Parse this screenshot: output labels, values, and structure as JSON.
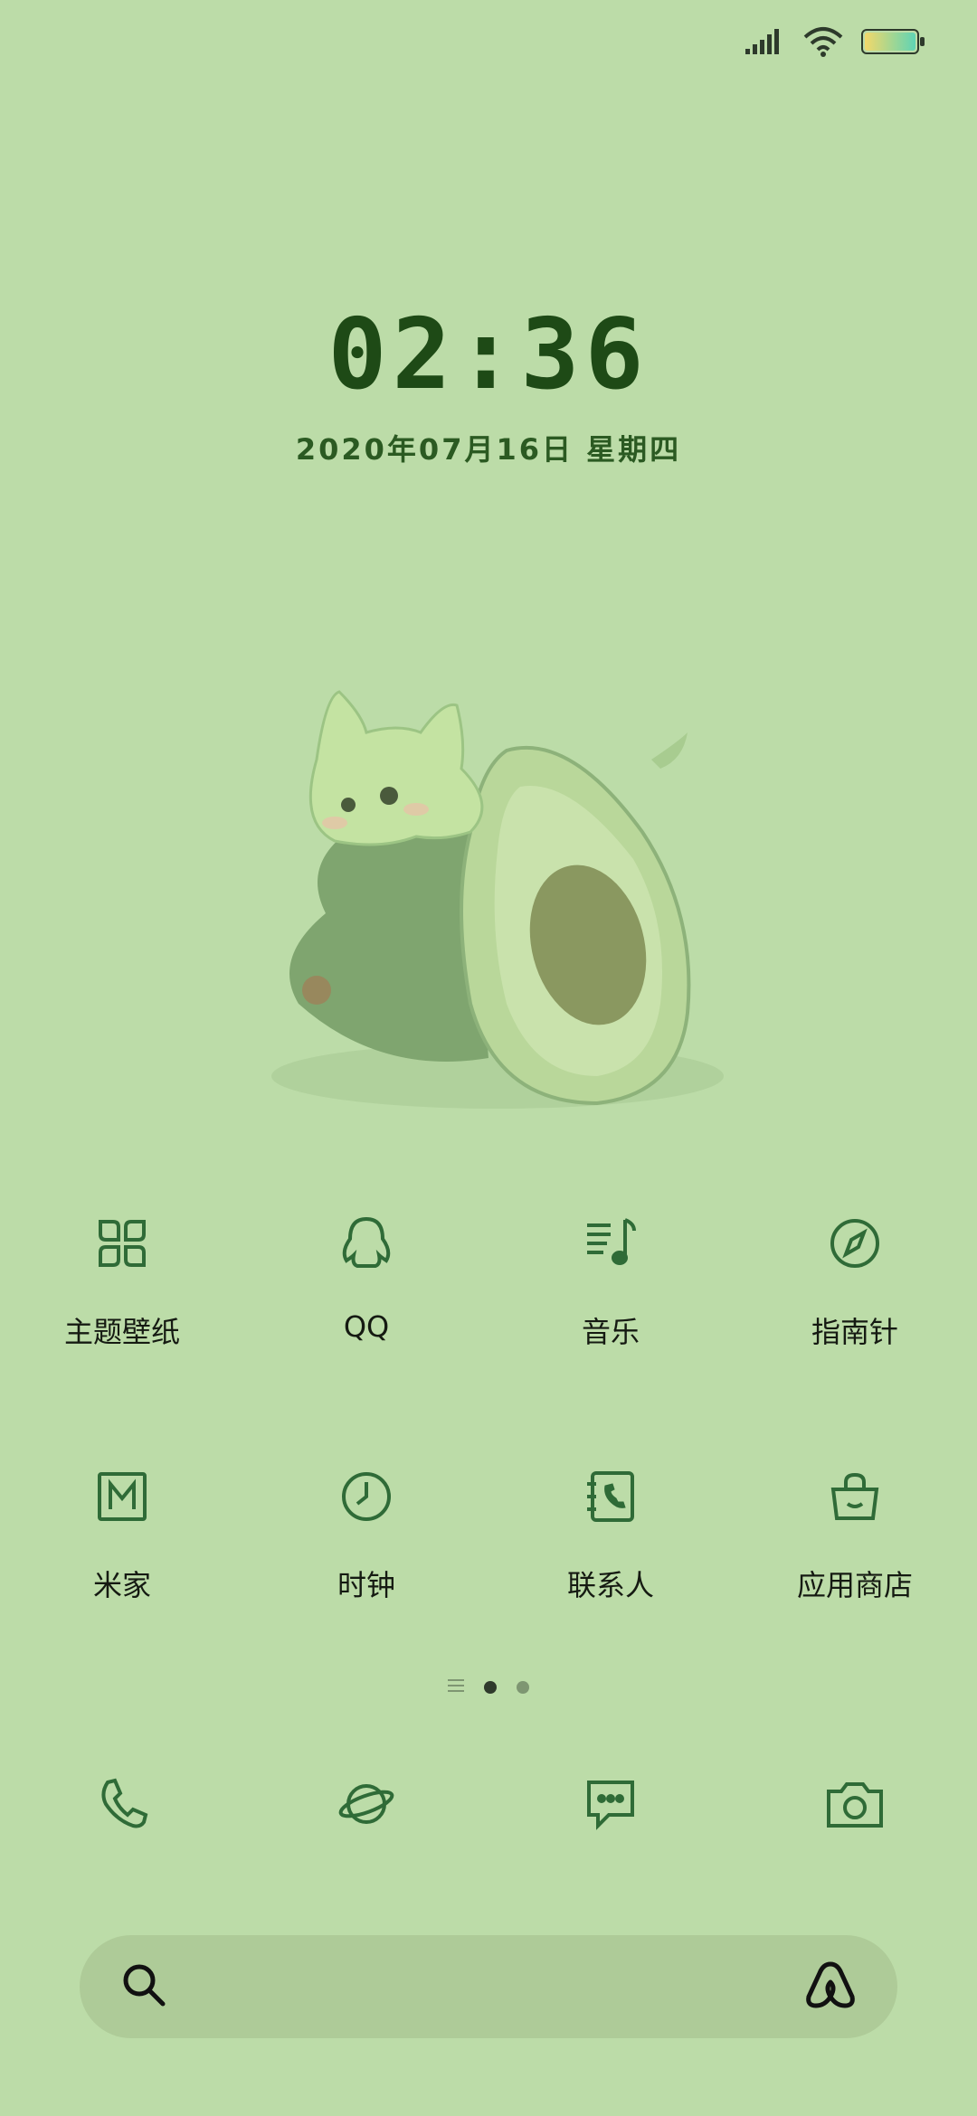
{
  "status_bar": {
    "signal_icon": "signal-bars-icon",
    "wifi_icon": "wifi-icon",
    "battery_icon": "battery-icon"
  },
  "lock_clock": {
    "time": "02:36",
    "date": "2020年07月16日 星期四"
  },
  "colors": {
    "background": "#bcdca8",
    "icon_stroke": "#2f6b37",
    "text": "#151a12",
    "clock": "#1e4a16"
  },
  "apps": [
    {
      "label": "主题壁纸",
      "icon": "theme-wallpaper-icon"
    },
    {
      "label": "QQ",
      "icon": "qq-penguin-icon"
    },
    {
      "label": "音乐",
      "icon": "music-icon"
    },
    {
      "label": "指南针",
      "icon": "compass-icon"
    },
    {
      "label": "米家",
      "icon": "mijia-icon"
    },
    {
      "label": "时钟",
      "icon": "clock-icon"
    },
    {
      "label": "联系人",
      "icon": "contacts-icon"
    },
    {
      "label": "应用商店",
      "icon": "app-store-icon"
    }
  ],
  "page_indicator": {
    "pages": 3,
    "current": 2
  },
  "dock": [
    {
      "icon": "phone-icon"
    },
    {
      "icon": "browser-planet-icon"
    },
    {
      "icon": "messages-icon"
    },
    {
      "icon": "camera-icon"
    }
  ],
  "search_bar": {
    "left_icon": "search-icon",
    "right_icon": "assistant-icon"
  }
}
